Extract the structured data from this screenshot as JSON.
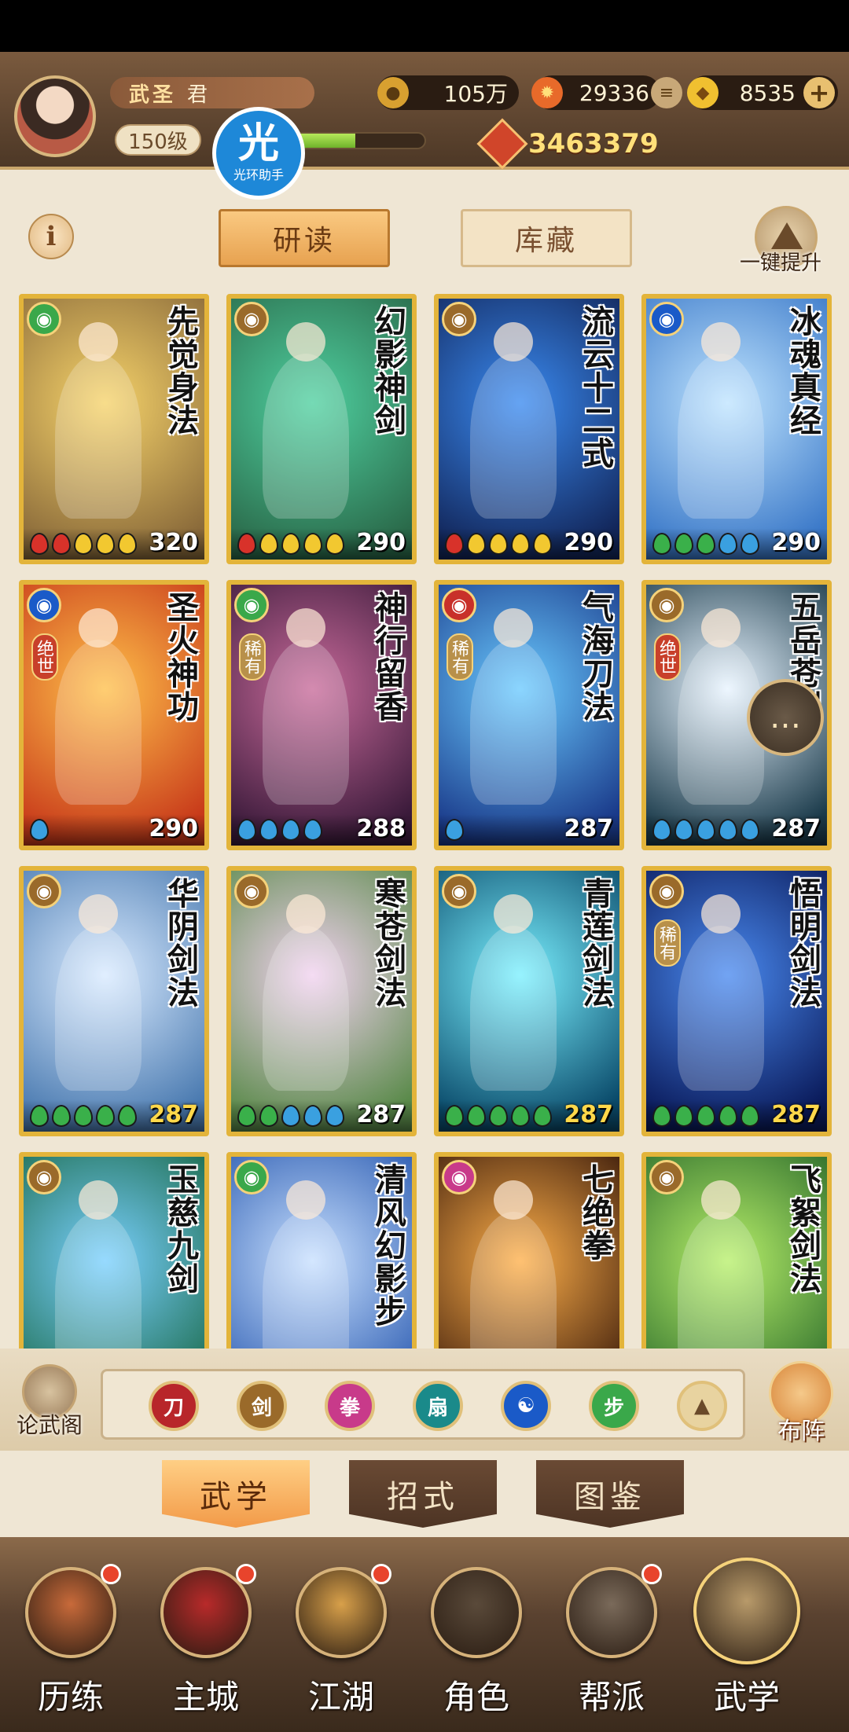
{
  "player": {
    "rank": "武圣",
    "name": "君",
    "level": "150级",
    "exp_fraction": 0.67,
    "power": "3463379"
  },
  "watermark": {
    "big": "光",
    "small": "光环助手"
  },
  "resources": {
    "silver": "105万",
    "energy": "29336",
    "gold": "8535"
  },
  "tabs": {
    "study": "研读",
    "storage": "库藏"
  },
  "upgrade_label": "一键提升",
  "info_label": "i",
  "cards": [
    {
      "name": "先觉身法",
      "school_color": "#3aa84a",
      "drops": [
        "#d8322a",
        "#d8322a",
        "#f2c830",
        "#f2c830",
        "#f2c830"
      ],
      "value": "320",
      "gold": false,
      "bg": [
        "#f6d36a",
        "#8a6a3a"
      ]
    },
    {
      "name": "幻影神剑",
      "school_color": "#9a6a2a",
      "drops": [
        "#d8322a",
        "#f2c830",
        "#f2c830",
        "#f2c830",
        "#f2c830"
      ],
      "value": "290",
      "gold": false,
      "bg": [
        "#4fd0a0",
        "#2a6a4a"
      ]
    },
    {
      "name": "流云十二式",
      "school_color": "#9a6a2a",
      "drops": [
        "#d8322a",
        "#f2c830",
        "#f2c830",
        "#f2c830",
        "#f2c830"
      ],
      "value": "290",
      "gold": false,
      "bg": [
        "#3a8af0",
        "#12265a"
      ]
    },
    {
      "name": "冰魂真经",
      "school_color": "#1a5ac8",
      "drops": [
        "#3ab04a",
        "#3ab04a",
        "#3ab04a",
        "#3aa0e0",
        "#3aa0e0"
      ],
      "value": "290",
      "gold": false,
      "bg": [
        "#bfe4ff",
        "#3a78c8"
      ]
    },
    {
      "name": "圣火神功",
      "school_color": "#1a5ac8",
      "rarity": "绝世",
      "rarity_color": "#c8402a",
      "drops": [
        "#3aa0e0"
      ],
      "value": "290",
      "gold": false,
      "bg": [
        "#ffc04a",
        "#c83a1a"
      ]
    },
    {
      "name": "神行留香",
      "school_color": "#3aa84a",
      "rarity": "稀有",
      "rarity_color": "#b8904a",
      "drops": [
        "#3aa0e0",
        "#3aa0e0",
        "#3aa0e0",
        "#3aa0e0"
      ],
      "value": "288",
      "gold": false,
      "bg": [
        "#c86a9a",
        "#3a1a3a"
      ]
    },
    {
      "name": "气海刀法",
      "school_color": "#c8302a",
      "rarity": "稀有",
      "rarity_color": "#b8904a",
      "drops": [
        "#3aa0e0"
      ],
      "value": "287",
      "gold": false,
      "bg": [
        "#6acaff",
        "#1a3a8a"
      ]
    },
    {
      "name": "五岳苍剑",
      "school_color": "#9a6a2a",
      "rarity": "绝世",
      "rarity_color": "#c8402a",
      "drops": [
        "#3aa0e0",
        "#3aa0e0",
        "#3aa0e0",
        "#3aa0e0",
        "#3aa0e0"
      ],
      "value": "287",
      "gold": false,
      "bg": [
        "#e8f4ff",
        "#1a3a4a"
      ]
    },
    {
      "name": "华阴剑法",
      "school_color": "#9a6a2a",
      "drops": [
        "#3ab04a",
        "#3ab04a",
        "#3ab04a",
        "#3ab04a",
        "#3ab04a"
      ],
      "value": "287",
      "gold": true,
      "bg": [
        "#d8eaff",
        "#4a7ab0"
      ]
    },
    {
      "name": "寒苍剑法",
      "school_color": "#9a6a2a",
      "drops": [
        "#3ab04a",
        "#3ab04a",
        "#3aa0e0",
        "#3aa0e0",
        "#3aa0e0"
      ],
      "value": "287",
      "gold": false,
      "bg": [
        "#f2d2f0",
        "#5a8a4a"
      ]
    },
    {
      "name": "青莲剑法",
      "school_color": "#9a6a2a",
      "drops": [
        "#3ab04a",
        "#3ab04a",
        "#3ab04a",
        "#3ab04a",
        "#3ab04a"
      ],
      "value": "287",
      "gold": true,
      "bg": [
        "#7af0ff",
        "#0a4a6a"
      ]
    },
    {
      "name": "悟明剑法",
      "school_color": "#9a6a2a",
      "rarity": "稀有",
      "rarity_color": "#b8904a",
      "drops": [
        "#3ab04a",
        "#3ab04a",
        "#3ab04a",
        "#3ab04a",
        "#3ab04a"
      ],
      "value": "287",
      "gold": true,
      "bg": [
        "#4a8af0",
        "#0a1a5a"
      ]
    },
    {
      "name": "玉慈九剑",
      "school_color": "#9a6a2a",
      "drops": [],
      "value": "",
      "gold": false,
      "bg": [
        "#7ad0ff",
        "#1a6a4a"
      ]
    },
    {
      "name": "清风幻影步",
      "school_color": "#3aa84a",
      "drops": [],
      "value": "",
      "gold": false,
      "bg": [
        "#c8e0ff",
        "#2a5ab0"
      ]
    },
    {
      "name": "七绝拳",
      "school_color": "#c83a8a",
      "drops": [],
      "value": "",
      "gold": false,
      "bg": [
        "#ffb04a",
        "#3a1a0a"
      ]
    },
    {
      "name": "飞絮剑法",
      "school_color": "#9a6a2a",
      "drops": [],
      "value": "",
      "gold": false,
      "bg": [
        "#b8f06a",
        "#2a6a2a"
      ]
    }
  ],
  "filter_bar": {
    "left_label": "论武阁",
    "right_label": "布阵",
    "icons": [
      {
        "name": "blade-school-icon",
        "color": "#b8262a",
        "glyph": "刀"
      },
      {
        "name": "sword-school-icon",
        "color": "#9a6a2a",
        "glyph": "剑"
      },
      {
        "name": "fist-school-icon",
        "color": "#c83a8a",
        "glyph": "拳"
      },
      {
        "name": "fan-school-icon",
        "color": "#1a8a8a",
        "glyph": "扇"
      },
      {
        "name": "taiji-school-icon",
        "color": "#1a5ac8",
        "glyph": "☯"
      },
      {
        "name": "qinggong-school-icon",
        "color": "#3aa84a",
        "glyph": "步"
      },
      {
        "name": "all-school-icon",
        "color": "#e8d3a0",
        "glyph": "▲"
      }
    ]
  },
  "subtabs": {
    "martial": "武学",
    "moves": "招式",
    "atlas": "图鉴"
  },
  "nav": [
    {
      "label": "历练",
      "dot": true,
      "color": "#c86a3a"
    },
    {
      "label": "主城",
      "dot": true,
      "color": "#b82a2a"
    },
    {
      "label": "江湖",
      "dot": true,
      "color": "#d8a04a"
    },
    {
      "label": "角色",
      "dot": false,
      "color": "#5a4a3a"
    },
    {
      "label": "帮派",
      "dot": true,
      "color": "#7a6a5a"
    },
    {
      "label": "武学",
      "dot": false,
      "color": "#b89a6a"
    }
  ],
  "chat_icon": "chat-bubble-icon"
}
